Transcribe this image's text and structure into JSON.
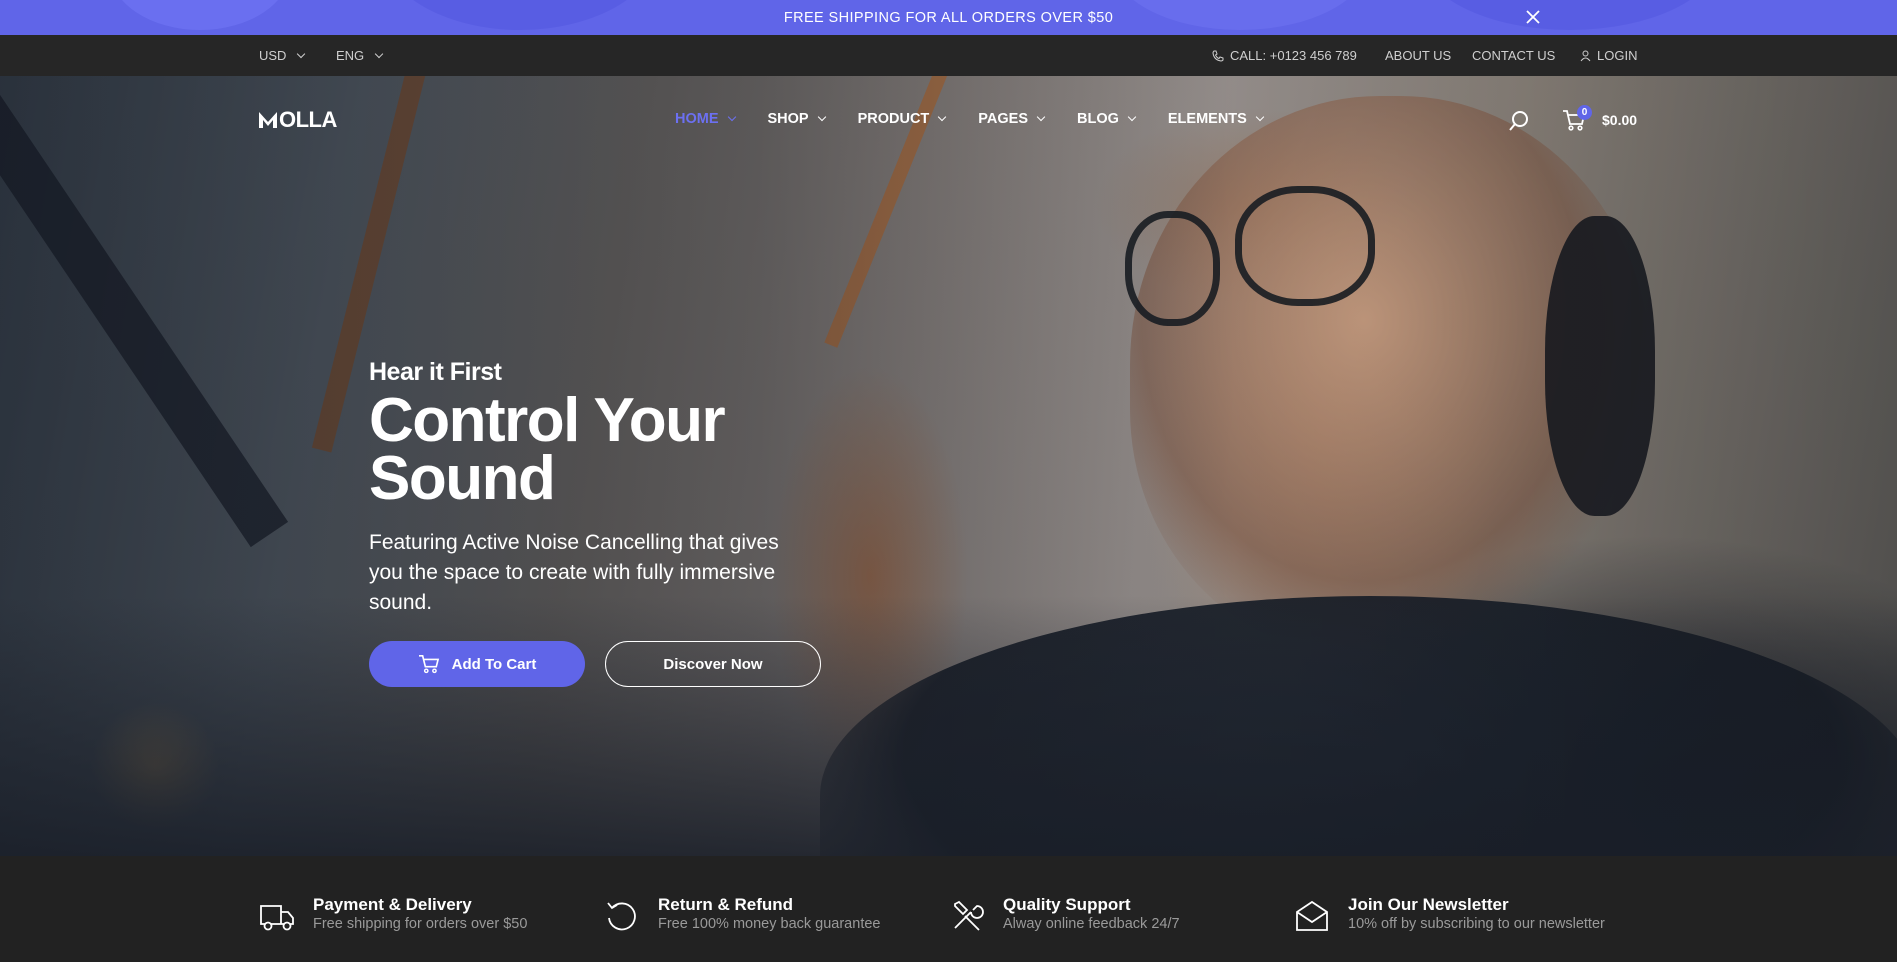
{
  "promo": {
    "message": "FREE SHIPPING FOR ALL ORDERS OVER $50",
    "close_icon": "close-icon"
  },
  "topbar": {
    "currency": "USD",
    "language": "ENG",
    "phone": "CALL: +0123 456 789",
    "about": "ABOUT US",
    "contact": "CONTACT US",
    "login": "LOGIN"
  },
  "header": {
    "logo": "OLLA",
    "nav": [
      {
        "label": "HOME",
        "active": true
      },
      {
        "label": "SHOP"
      },
      {
        "label": "PRODUCT"
      },
      {
        "label": "PAGES"
      },
      {
        "label": "BLOG"
      },
      {
        "label": "ELEMENTS"
      }
    ],
    "cart_count": "0",
    "cart_total": "$0.00"
  },
  "hero": {
    "kicker": "Hear it First",
    "headline_line1": "Control Your",
    "headline_line2": "Sound",
    "subtitle": "Featuring Active Noise Cancelling that gives you the space to create with fully immersive sound.",
    "primary_button": "Add To Cart",
    "secondary_button": "Discover Now"
  },
  "features": [
    {
      "title": "Payment & Delivery",
      "desc": "Free shipping for orders over $50",
      "icon": "truck-icon"
    },
    {
      "title": "Return & Refund",
      "desc": "Free 100% money back guarantee",
      "icon": "refund-icon"
    },
    {
      "title": "Quality Support",
      "desc": "Alway online feedback 24/7",
      "icon": "tools-icon"
    },
    {
      "title": "Join Our Newsletter",
      "desc": "10% off by subscribing to our newsletter",
      "icon": "envelope-icon"
    }
  ],
  "colors": {
    "accent": "#6065e8",
    "promo_bg": "#6065e8",
    "dark": "#222222"
  }
}
